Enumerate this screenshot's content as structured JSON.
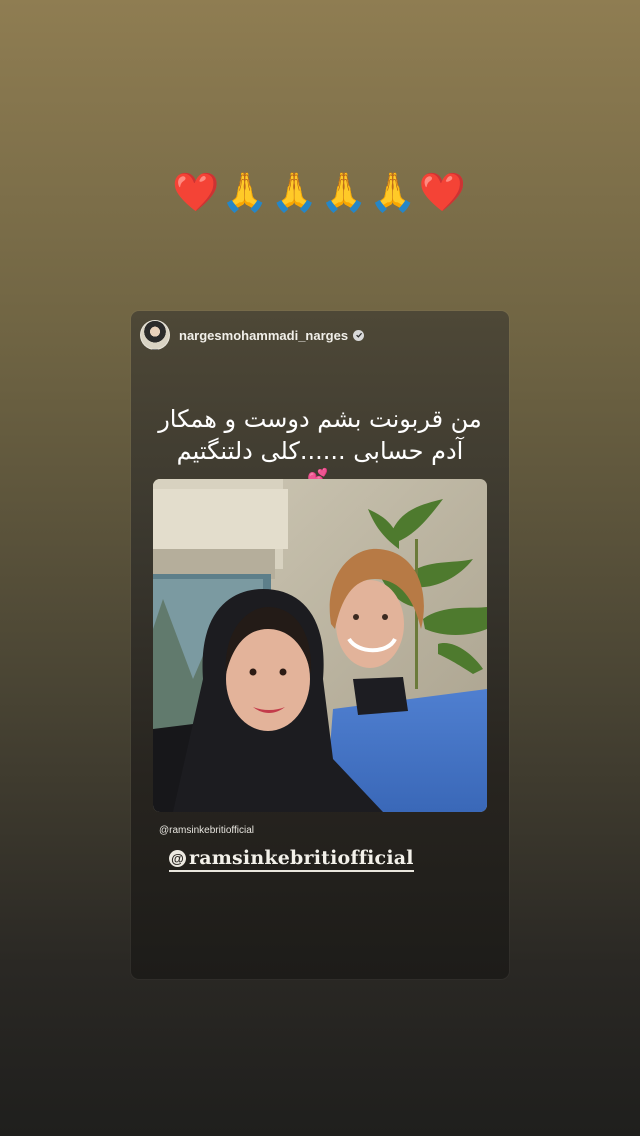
{
  "story": {
    "emoji_line": "❤️🙏🙏🙏🙏❤️"
  },
  "shared_post": {
    "username": "nargesmohammadi_narges",
    "verified": true,
    "caption_line1": "من قربونت بشم دوست و همکار",
    "caption_line2": "آدم حسابی ......کلی دلتنگتیم",
    "caption_emoji": "💕",
    "photo_tag": "@ramsinkebritiofficial"
  },
  "mention_sticker": {
    "at_symbol": "@",
    "handle": "ramsinkebritiofficial"
  },
  "colors": {
    "background_top": "#8f7d52",
    "background_bottom": "#1f1f1d",
    "card_top": "#4e4837",
    "text": "#ffffff"
  }
}
